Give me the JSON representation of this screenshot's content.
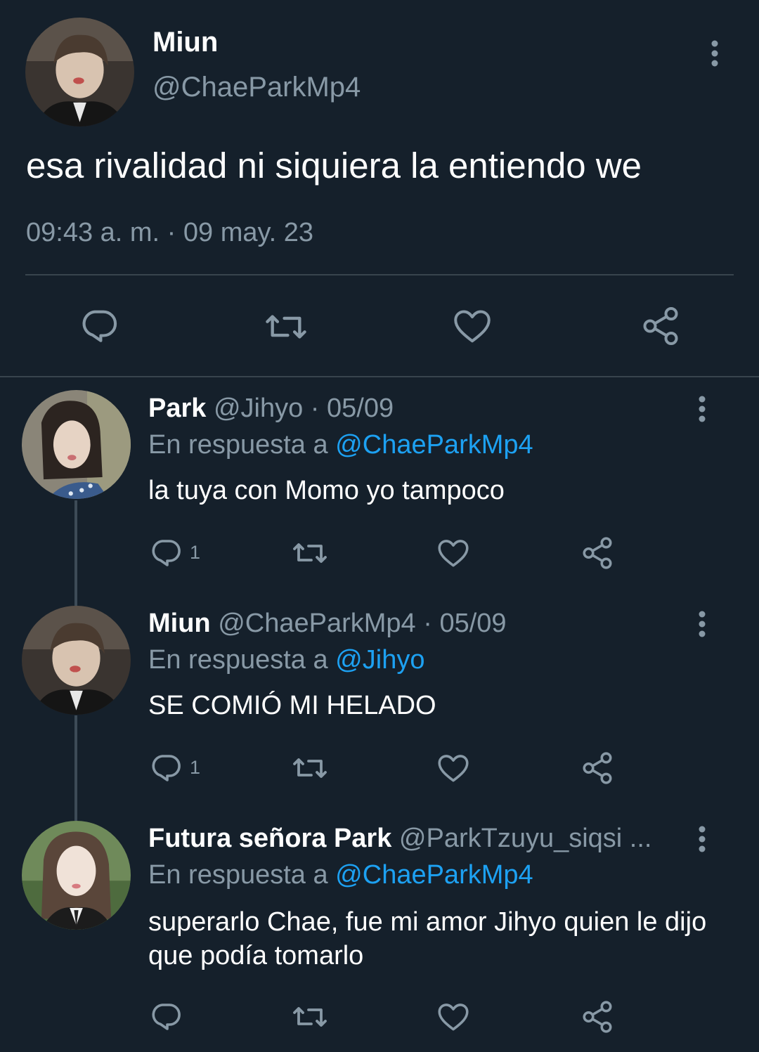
{
  "main_tweet": {
    "author_name": "Miun",
    "author_handle": "@ChaeParkMp4",
    "text": "esa rivalidad ni siquiera la entiendo we",
    "timestamp": "09:43 a. m. · 09 may. 23",
    "icons": [
      "reply-icon",
      "retweet-icon",
      "like-icon",
      "share-icon",
      "more-icon"
    ]
  },
  "replies": [
    {
      "name": "Park",
      "meta": "@Jihyo · 05/09",
      "reply_prefix": "En respuesta a",
      "reply_to": "@ChaeParkMp4",
      "text": "la tuya con Momo yo tampoco",
      "reply_count": "1"
    },
    {
      "name": "Miun",
      "meta": "@ChaeParkMp4 · 05/09",
      "reply_prefix": "En respuesta a",
      "reply_to": "@Jihyo",
      "text": "SE COMIÓ MI HELADO",
      "reply_count": "1"
    },
    {
      "name": "Futura señora Park",
      "meta": "@ParkTzuyu_siqsi ...",
      "reply_prefix": "En respuesta a",
      "reply_to": "@ChaeParkMp4",
      "text": "superarlo Chae, fue mi amor Jihyo quien le dijo que podía tomarlo",
      "reply_count": ""
    }
  ],
  "colors": {
    "background": "#15202b",
    "secondary_text": "#8899a6",
    "mention": "#1da1f2",
    "divider": "#38444d"
  }
}
